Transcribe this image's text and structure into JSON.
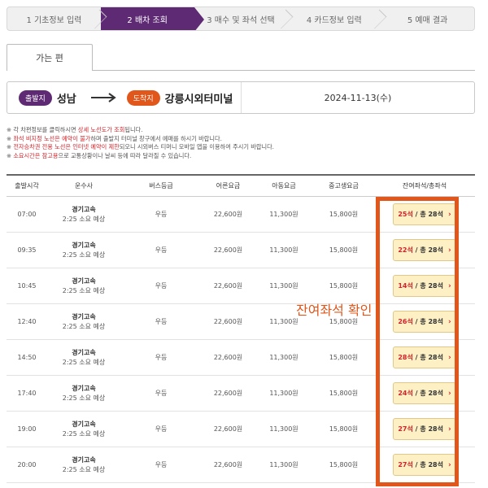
{
  "steps": [
    {
      "label": "1 기초정보 입력",
      "active": false
    },
    {
      "label": "2 배차 조회",
      "active": true
    },
    {
      "label": "3 매수 및 좌석 선택",
      "active": false
    },
    {
      "label": "4 카드정보 입력",
      "active": false
    },
    {
      "label": "5 예매 결과",
      "active": false
    }
  ],
  "tab": {
    "label": "가는 편"
  },
  "route": {
    "dep_badge": "출발지",
    "dep_city": "성남",
    "arr_badge": "도착지",
    "arr_city": "강릉시외터미널",
    "date": "2024-11-13(수)"
  },
  "notices": {
    "n1_a": "※ 각 차편정보를 클릭하시면 ",
    "n1_b": "상세 노선도가 조회",
    "n1_c": "됩니다.",
    "n2_a": "※ ",
    "n2_b": "좌석 비지정 노선은 예약이 불가",
    "n2_c": "하며 출발지 터미널 창구에서 예매를 하시기 바랍니다.",
    "n3_a": "※ ",
    "n3_b": "전자승차권 전용 노선은 인터넷 예약이 제한",
    "n3_c": "되오니 시외버스 티머니 모바일 앱을 이용하여 주시기 바랍니다.",
    "n4_a": "※ ",
    "n4_b": "소요시간은 참고용",
    "n4_c": "으로 교통상황이나 날씨 등에 따라 달라질 수 있습니다."
  },
  "table": {
    "headers": [
      "출발시각",
      "운수사",
      "버스등급",
      "어른요금",
      "아동요금",
      "중고생요금",
      "잔여좌석/총좌석"
    ],
    "rows": [
      {
        "time": "07:00",
        "company": "경기고속",
        "duration": "2:25 소요 예상",
        "grade": "우등",
        "adult": "22,600원",
        "child": "11,300원",
        "teen": "15,800원",
        "remain": "25석",
        "total": "/ 총 28석"
      },
      {
        "time": "09:35",
        "company": "경기고속",
        "duration": "2:25 소요 예상",
        "grade": "우등",
        "adult": "22,600원",
        "child": "11,300원",
        "teen": "15,800원",
        "remain": "22석",
        "total": "/ 총 28석"
      },
      {
        "time": "10:45",
        "company": "경기고속",
        "duration": "2:25 소요 예상",
        "grade": "우등",
        "adult": "22,600원",
        "child": "11,300원",
        "teen": "15,800원",
        "remain": "14석",
        "total": "/ 총 28석"
      },
      {
        "time": "12:40",
        "company": "경기고속",
        "duration": "2:25 소요 예상",
        "grade": "우등",
        "adult": "22,600원",
        "child": "11,300원",
        "teen": "15,800원",
        "remain": "26석",
        "total": "/ 총 28석"
      },
      {
        "time": "14:50",
        "company": "경기고속",
        "duration": "2:25 소요 예상",
        "grade": "우등",
        "adult": "22,600원",
        "child": "11,300원",
        "teen": "15,800원",
        "remain": "28석",
        "total": "/ 총 28석"
      },
      {
        "time": "17:40",
        "company": "경기고속",
        "duration": "2:25 소요 예상",
        "grade": "우등",
        "adult": "22,600원",
        "child": "11,300원",
        "teen": "15,800원",
        "remain": "24석",
        "total": "/ 총 28석"
      },
      {
        "time": "19:00",
        "company": "경기고속",
        "duration": "2:25 소요 예상",
        "grade": "우등",
        "adult": "22,600원",
        "child": "11,300원",
        "teen": "15,800원",
        "remain": "27석",
        "total": "/ 총 28석"
      },
      {
        "time": "20:00",
        "company": "경기고속",
        "duration": "2:25 소요 예상",
        "grade": "우등",
        "adult": "22,600원",
        "child": "11,300원",
        "teen": "15,800원",
        "remain": "27석",
        "total": "/ 총 28석"
      }
    ]
  },
  "annotation": "잔여좌석 확인",
  "colors": {
    "primary": "#5e2a73",
    "accent": "#e0561b",
    "seat_bg": "#fdf0c5",
    "warn": "#d2232a"
  }
}
